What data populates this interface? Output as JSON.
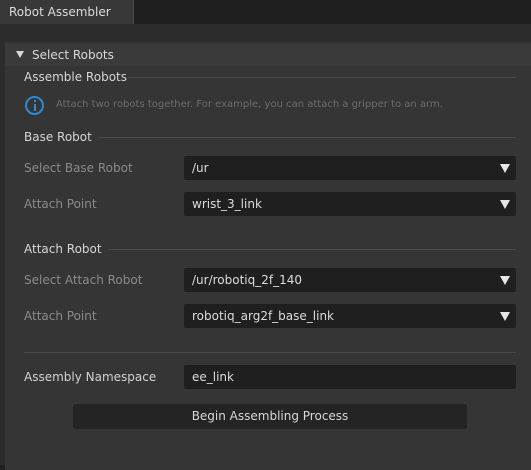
{
  "tab": {
    "title": "Robot Assembler"
  },
  "collapsible": {
    "label": "Select Robots"
  },
  "assemble": {
    "title": "Assemble Robots",
    "info_text": "Attach two robots together. For example, you can attach a gripper to an arm."
  },
  "base_robot": {
    "title": "Base Robot",
    "select_label": "Select Base Robot",
    "select_value": "/ur",
    "attach_label": "Attach Point",
    "attach_value": "wrist_3_link"
  },
  "attach_robot": {
    "title": "Attach Robot",
    "select_label": "Select Attach Robot",
    "select_value": "/ur/robotiq_2f_140",
    "attach_label": "Attach Point",
    "attach_value": "robotiq_arg2f_base_link"
  },
  "namespace": {
    "label": "Assembly Namespace",
    "value": "ee_link"
  },
  "actions": {
    "begin_label": "Begin Assembling Process"
  },
  "colors": {
    "info_accent": "#2d8ad4",
    "background": "#353535",
    "field": "#1f1f1f"
  }
}
